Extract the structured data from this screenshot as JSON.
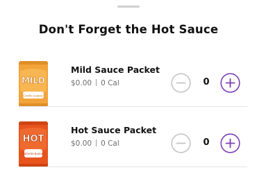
{
  "sheet": {
    "title": "Don't Forget the Hot Sauce"
  },
  "items": [
    {
      "name": "Mild Sauce Packet",
      "price": "$0.00",
      "calories": "0 Cal",
      "quantity": "0",
      "packet_label": "MILD",
      "packet_sticker": "Coolo suave!",
      "packet_color": "#f2a33a"
    },
    {
      "name": "Hot Sauce Packet",
      "price": "$0.00",
      "calories": "0 Cal",
      "quantity": "0",
      "packet_label": "HOT",
      "packet_sticker": "Caliente bueno!",
      "packet_color": "#e8541e"
    }
  ],
  "icons": {
    "decrement": "minus-circle-icon",
    "increment": "plus-circle-icon"
  },
  "colors": {
    "accent_purple": "#7b3fb8",
    "disabled_gray": "#c4c4c4"
  }
}
